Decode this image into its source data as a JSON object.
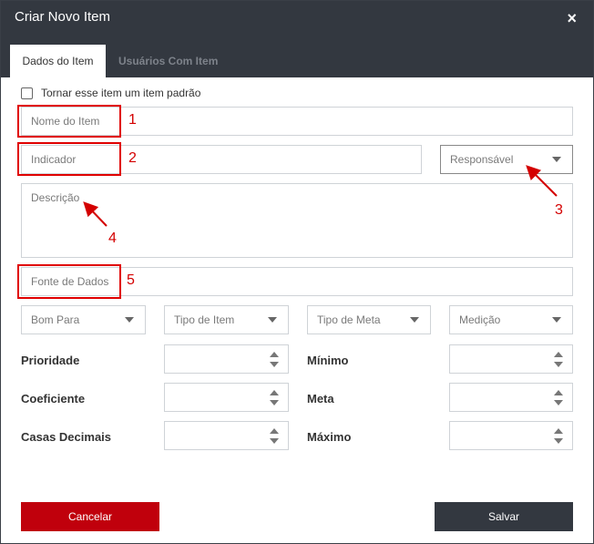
{
  "dialog": {
    "title": "Criar Novo Item",
    "close_icon": "×"
  },
  "tabs": [
    {
      "label": "Dados do Item",
      "active": true
    },
    {
      "label": "Usuários Com Item",
      "active": false
    }
  ],
  "form": {
    "default_checkbox_label": "Tornar esse item um item padrão",
    "nome_placeholder": "Nome do Item",
    "indicador_placeholder": "Indicador",
    "responsavel_select": "Responsável",
    "descricao_placeholder": "Descrição",
    "fonte_placeholder": "Fonte de Dados",
    "selects": [
      "Bom Para",
      "Tipo de Item",
      "Tipo de Meta",
      "Medição"
    ],
    "numeric_labels": {
      "prioridade": "Prioridade",
      "coeficiente": "Coeficiente",
      "casas_decimais": "Casas Decimais",
      "minimo": "Mínimo",
      "meta": "Meta",
      "maximo": "Máximo"
    }
  },
  "annotations": [
    "1",
    "2",
    "3",
    "4",
    "5"
  ],
  "buttons": {
    "cancel": "Cancelar",
    "save": "Salvar"
  },
  "colors": {
    "header_bg": "#333840",
    "cancel_bg": "#c0000c",
    "save_bg": "#333840",
    "annotation_red": "#e00000"
  }
}
